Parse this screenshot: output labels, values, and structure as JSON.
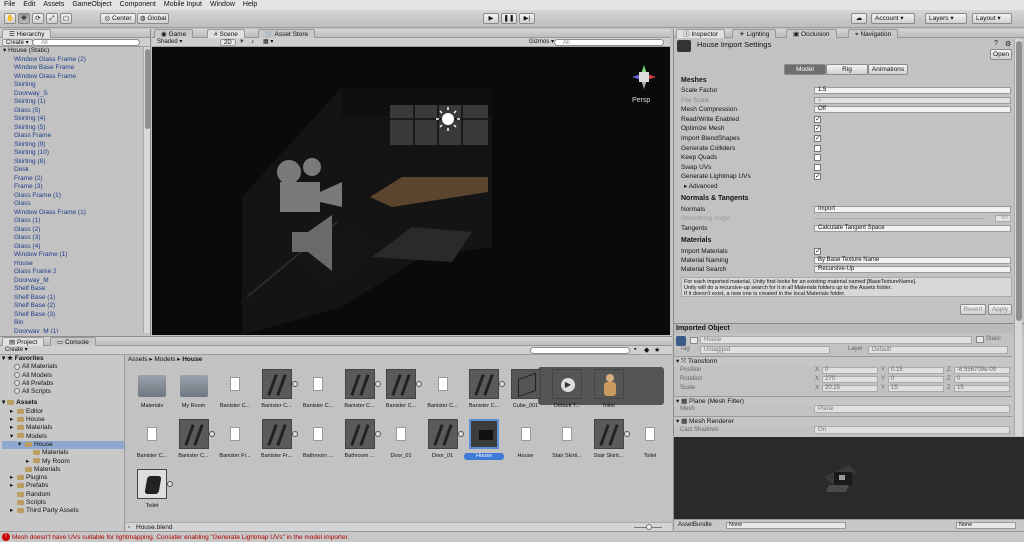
{
  "menu": [
    "File",
    "Edit",
    "Assets",
    "GameObject",
    "Component",
    "Mobile Input",
    "Window",
    "Help"
  ],
  "toolbar": {
    "center": "Center",
    "global": "Global",
    "account": "Account",
    "layers": "Layers",
    "layout": "Layout"
  },
  "hierarchy": {
    "tab": "Hierarchy",
    "create": "Create",
    "search_placeholder": "All",
    "root": "House (Static)",
    "items": [
      "Window Glass Frame (2)",
      "Window Base Frame",
      "Window Glass Frame",
      "Skirting",
      "Doorway_S",
      "Skirting (1)",
      "Glass (5)",
      "Skirting (4)",
      "Skirting (5)",
      "Glass Frame",
      "Skirting (9)",
      "Skirting (10)",
      "Skirting (8)",
      "Desk",
      "Frame (2)",
      "Frame (3)",
      "Glass Frame (1)",
      "Glass",
      "Window Glass Frame (1)",
      "Glass (1)",
      "Glass (2)",
      "Glass (3)",
      "Glass (4)",
      "Window Frame (1)",
      "House",
      "Glass Frame 2",
      "Doorway_M",
      "Shelf Base",
      "Shelf Base (1)",
      "Shelf Base (2)",
      "Shelf Base (3)",
      "Bin",
      "Doorway_M (1)"
    ]
  },
  "scene": {
    "tab_game": "Game",
    "tab_scene": "Scene",
    "tab_store": "Asset Store",
    "shaded": "Shaded",
    "mode2d": "2D",
    "gizmos": "Gizmos",
    "search_placeholder": "All",
    "persp": "Persp"
  },
  "inspector": {
    "tab_inspector": "Inspector",
    "tab_lighting": "Lighting",
    "tab_occlusion": "Occlusion",
    "tab_navigation": "Navigation",
    "title": "House Import Settings",
    "open": "Open",
    "tabs": [
      "Model",
      "Rig",
      "Animations"
    ],
    "meshes_header": "Meshes",
    "scale_factor_label": "Scale Factor",
    "scale_factor": "1.5",
    "file_scale_label": "File Scale",
    "file_scale": "1",
    "mesh_compression_label": "Mesh Compression",
    "mesh_compression": "Off",
    "read_write_label": "Read/Write Enabled",
    "optimize_mesh_label": "Optimize Mesh",
    "import_blend_label": "Import BlendShapes",
    "gen_colliders_label": "Generate Colliders",
    "keep_quads_label": "Keep Quads",
    "swap_uvs_label": "Swap UVs",
    "gen_lightmap_label": "Generate Lightmap UVs",
    "advanced": "Advanced",
    "normals_header": "Normals & Tangents",
    "normals_label": "Normals",
    "normals": "Import",
    "smoothing_label": "Smoothing Angle",
    "smoothing": "60",
    "tangents_label": "Tangents",
    "tangents": "Calculate Tangent Space",
    "materials_header": "Materials",
    "import_materials_label": "Import Materials",
    "material_naming_label": "Material Naming",
    "material_naming": "By Base Texture Name",
    "material_search_label": "Material Search",
    "material_search": "Recursive-Up",
    "help_lines": [
      "For each imported material, Unity first looks for an existing material named [BaseTextureName].",
      "Unity will do a recursive-up search for it in all Materials folders up to the Assets folder.",
      "If it doesn't exist, a new one is created in the local Materials folder."
    ],
    "revert": "Revert",
    "apply": "Apply",
    "imported_object": "Imported Object",
    "object_name": "House",
    "static": "Static",
    "tag_label": "Tag",
    "tag": "Untagged",
    "layer_label": "Layer",
    "layer": "Default",
    "transform": "Transform",
    "position_label": "Position",
    "position": [
      "0",
      "0.15",
      "-6.556709e-09"
    ],
    "rotation_label": "Rotation",
    "rotation": [
      "270",
      "0",
      "0"
    ],
    "scale_label": "Scale",
    "scale": [
      "20.25",
      "15",
      "15"
    ],
    "mesh_filter": "Plane (Mesh Filter)",
    "mesh_label": "Mesh",
    "mesh": "Plane",
    "mesh_renderer": "Mesh Renderer",
    "cast_shadows_label": "Cast Shadows",
    "cast_shadows": "On",
    "asset_bundle_label": "AssetBundle",
    "asset_bundle": "None",
    "asset_variant": "None"
  },
  "project": {
    "tab_project": "Project",
    "tab_console": "Console",
    "create": "Create",
    "favorites": "Favorites",
    "fav_items": [
      "All Materials",
      "All Models",
      "All Prefabs",
      "All Scripts"
    ],
    "assets_root": "Assets",
    "tree": [
      "Editor",
      "House",
      "Materials",
      "Models",
      "House",
      "Materials",
      "My Room",
      "Materials",
      "Plugins",
      "Prefabs",
      "Random",
      "Scripts",
      "Third Party Assets"
    ],
    "breadcrumb": [
      "Assets",
      "Models",
      "House"
    ],
    "assets_row1": [
      "Materials",
      "My Room",
      "Banister C...",
      "Banister C...",
      "Banister C...",
      "Banister C...",
      "Banister C...",
      "Banister C...",
      "Banister C...",
      "Cube_001",
      "Default T...",
      "Toilet"
    ],
    "assets_row2": [
      "Banister C...",
      "Banister C...",
      "Banister Fr...",
      "Banister Fr...",
      "Bathroom ...",
      "Bathroom ...",
      "Door_01",
      "Door_01",
      "House",
      "House",
      "Stair Skirti...",
      "Stair Skirti...",
      "Toilet"
    ],
    "assets_row3": [
      "Toilet"
    ],
    "footer_file": "House.blend"
  },
  "status": {
    "message": "Mesh doesn't have UVs suitable for lightmapping. Consider enabling \"Generate Lightmap UVs\" in the model importer."
  }
}
